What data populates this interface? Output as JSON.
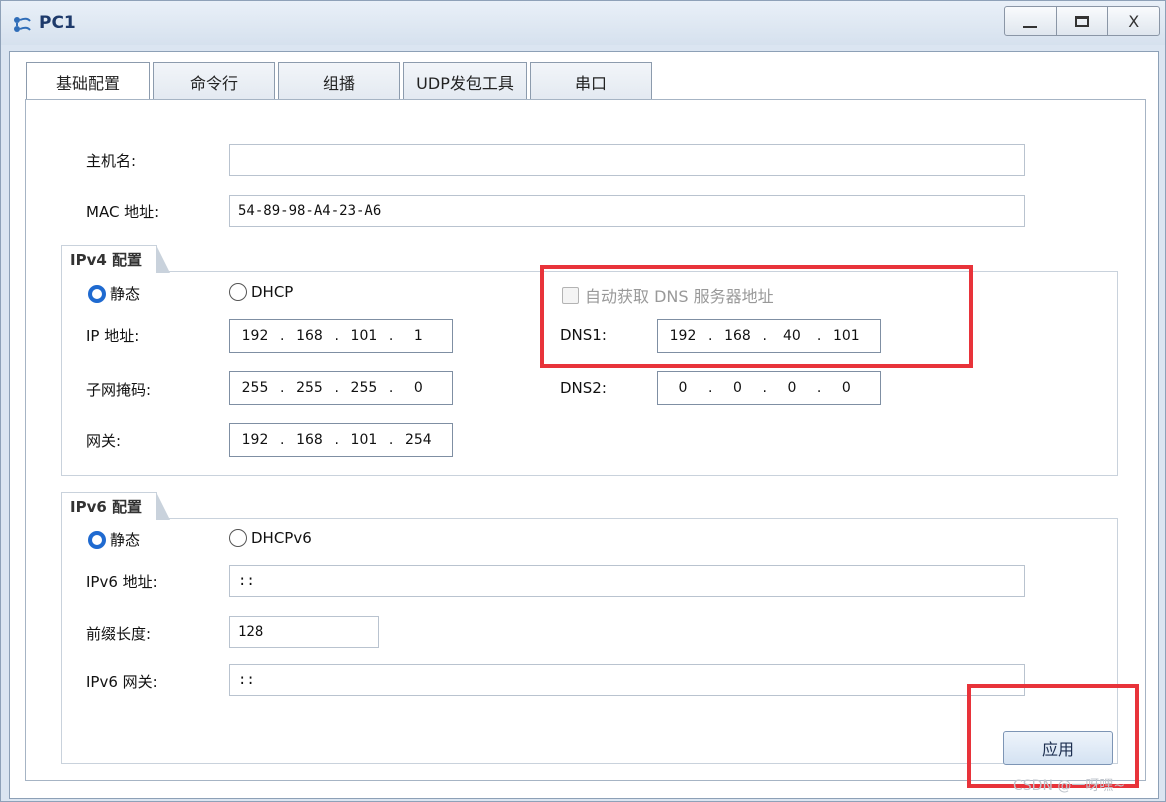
{
  "window": {
    "title": "PC1",
    "icon": "network-pc-icon",
    "controls": {
      "minimize": "minimize-icon",
      "maximize": "maximize-icon",
      "close": "X"
    }
  },
  "tabs": [
    {
      "label": "基础配置",
      "active": true
    },
    {
      "label": "命令行",
      "active": false
    },
    {
      "label": "组播",
      "active": false
    },
    {
      "label": "UDP发包工具",
      "active": false
    },
    {
      "label": "串口",
      "active": false
    }
  ],
  "basic": {
    "hostname_label": "主机名:",
    "hostname_value": "",
    "mac_label": "MAC 地址:",
    "mac_value": "54-89-98-A4-23-A6"
  },
  "ipv4": {
    "group_title": "IPv4 配置",
    "static_label": "静态",
    "dhcp_label": "DHCP",
    "mode": "static",
    "ip_label": "IP 地址:",
    "ip": [
      "192",
      "168",
      "101",
      "1"
    ],
    "mask_label": "子网掩码:",
    "mask": [
      "255",
      "255",
      "255",
      "0"
    ],
    "gateway_label": "网关:",
    "gateway": [
      "192",
      "168",
      "101",
      "254"
    ],
    "auto_dns_label": "自动获取 DNS 服务器地址",
    "auto_dns_checked": false,
    "dns1_label": "DNS1:",
    "dns1": [
      "192",
      "168",
      "40",
      "101"
    ],
    "dns2_label": "DNS2:",
    "dns2": [
      "0",
      "0",
      "0",
      "0"
    ]
  },
  "ipv6": {
    "group_title": "IPv6 配置",
    "static_label": "静态",
    "dhcp_label": "DHCPv6",
    "mode": "static",
    "addr_label": "IPv6 地址:",
    "addr_value": "::",
    "prefix_label": "前缀长度:",
    "prefix_value": "128",
    "gateway_label": "IPv6 网关:",
    "gateway_value": "::"
  },
  "apply_label": "应用",
  "watermark": "CSDN @一呀嘿~",
  "colors": {
    "highlight": "#e8333a",
    "radio_selected": "#1f6ad0"
  }
}
